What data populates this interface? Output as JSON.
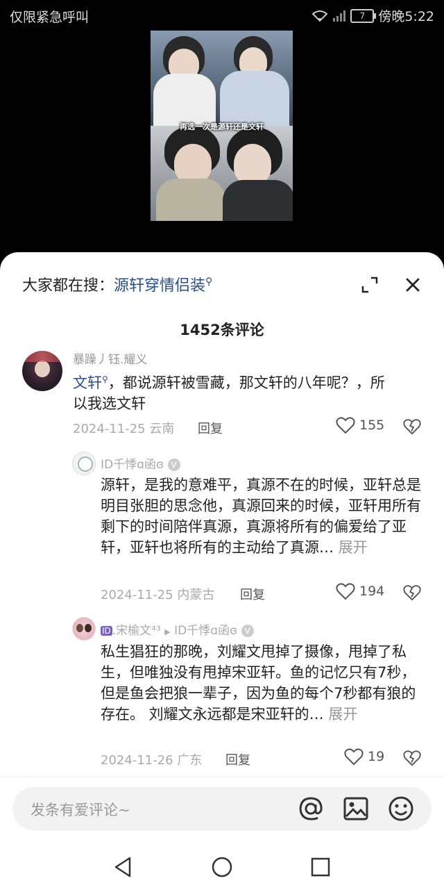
{
  "status": {
    "left": "仅限紧急呼叫",
    "battery": "7",
    "right_text": "傍晚5:22"
  },
  "video": {
    "caption": "再选一次是源轩还是文轩"
  },
  "sheet": {
    "search_label": "大家都在搜：",
    "search_term": "源轩穿情侣装",
    "comment_count": "1452条评论"
  },
  "comments": [
    {
      "username": "暴躁丿钰.耀义",
      "mention": "文轩",
      "text": "，都说源轩被雪藏，那文轩的八年呢？，所以我选文轩",
      "date_loc": "2024-11-25 云南",
      "reply_label": "回复",
      "likes": "155"
    },
    {
      "username": "ID千悸ɑ函ɞ",
      "text": "源轩，是我的意难平，真源不在的时候，亚轩总是明目张胆的思念他，真源回来的时候，亚轩用所有剩下的时间陪伴真源，真源将所有的偏爱给了亚轩，亚轩也将所有的主动给了真源…",
      "expand_label": "展开",
      "date_loc": "2024-11-25 内蒙古",
      "reply_label": "回复",
      "likes": "194"
    },
    {
      "badge": "ID",
      "username": ".宋榆文⁴³",
      "reply_to": "ID千悸ɑ函ɞ",
      "text": "私生猖狂的那晚，刘耀文甩掉了摄像，甩掉了私生，但唯独没有甩掉宋亚轩。鱼的记忆只有7秒，但是鱼会把狼一辈子，因为鱼的每个7秒都有狼的存在。  刘耀文永远都是宋亚轩的…",
      "expand_label": "展开",
      "date_loc": "2024-11-26 广东",
      "reply_label": "回复",
      "likes": "19"
    }
  ],
  "input": {
    "placeholder": "发条有爱评论~"
  },
  "icons": [
    "search-icon",
    "expand-icon",
    "close-icon",
    "heart-icon",
    "dislike-icon",
    "at-icon",
    "image-icon",
    "emoji-icon",
    "back-icon",
    "home-icon",
    "recents-icon"
  ]
}
